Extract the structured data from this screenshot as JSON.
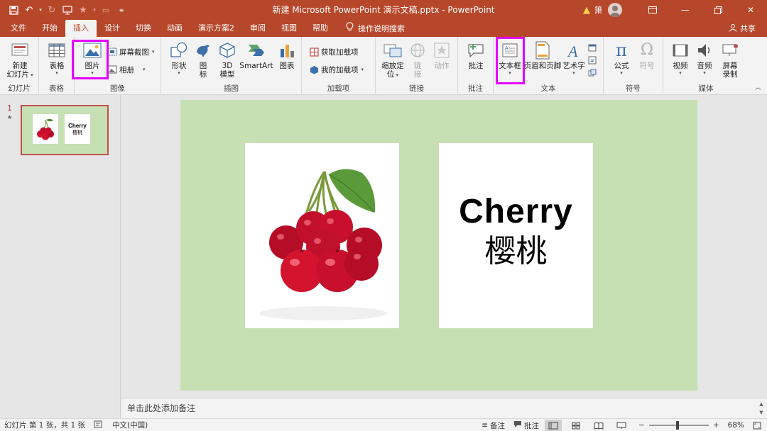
{
  "title_bar": {
    "title": "新建 Microsoft PowerPoint 演示文稿.pptx  -  PowerPoint",
    "user_name": "箫",
    "warning_icon": "warning-icon"
  },
  "tabs": [
    {
      "label": "文件"
    },
    {
      "label": "开始"
    },
    {
      "label": "插入",
      "active": true
    },
    {
      "label": "设计"
    },
    {
      "label": "切换"
    },
    {
      "label": "动画"
    },
    {
      "label": "演示方案2"
    },
    {
      "label": "审阅"
    },
    {
      "label": "视图"
    },
    {
      "label": "帮助"
    }
  ],
  "tell_me": "操作说明搜索",
  "share_label": "共享",
  "ribbon": {
    "slides": {
      "new_slide_1": "新建",
      "new_slide_2": "幻灯片",
      "group_label": "幻灯片"
    },
    "tables": {
      "table": "表格",
      "group_label": "表格"
    },
    "images": {
      "picture": "图片",
      "screenshot": "屏幕截图",
      "album": "相册",
      "group_label": "图像"
    },
    "illustrations": {
      "shapes": "形状",
      "icons_1": "图",
      "icons_2": "标",
      "model_1": "3D",
      "model_2": "模型",
      "smartart": "SmartArt",
      "chart": "图表",
      "group_label": "插图"
    },
    "addins": {
      "get_addins": "获取加载项",
      "my_addins": "我的加载项",
      "group_label": "加载项"
    },
    "links": {
      "zoom_1": "缩放定",
      "zoom_2": "位",
      "link_1": "链",
      "link_2": "接",
      "action": "动作",
      "group_label": "链接"
    },
    "comments": {
      "comment": "批注",
      "group_label": "批注"
    },
    "text": {
      "textbox": "文本框",
      "header_footer": "页眉和页脚",
      "wordart": "艺术字",
      "group_label": "文本"
    },
    "symbols": {
      "equation": "公式",
      "symbol": "符号",
      "group_label": "符号"
    },
    "media": {
      "video": "视频",
      "audio": "音频",
      "screen_rec_1": "屏幕",
      "screen_rec_2": "录制",
      "group_label": "媒体"
    }
  },
  "thumbnails": {
    "slide_number": "1",
    "thumb_text_en": "Cherry",
    "thumb_text_zh": "樱桃"
  },
  "slide": {
    "text_en": "Cherry",
    "text_zh": "樱桃",
    "background_color": "#c6e0b4"
  },
  "notes_placeholder": "单击此处添加备注",
  "status": {
    "slide_info": "幻灯片 第 1 张，共 1 张",
    "language": "中文(中国)",
    "notes": "备注",
    "comments": "批注",
    "zoom": "68%"
  },
  "colors": {
    "accent": "#b7472a",
    "highlight": "#e400ff"
  }
}
